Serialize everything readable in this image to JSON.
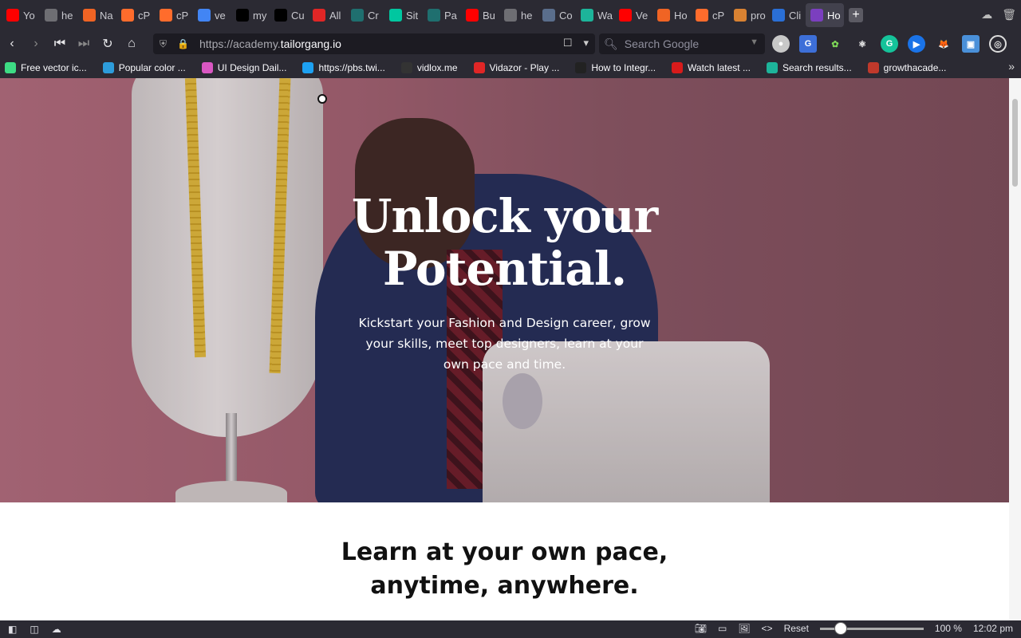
{
  "browser": {
    "tabs": [
      {
        "label": "Yo",
        "icon": "youtube-icon",
        "color": "#ff0000"
      },
      {
        "label": "he",
        "icon": "github-icon",
        "color": "#6e6e73"
      },
      {
        "label": "Na",
        "icon": "namecheap-icon",
        "color": "#f06424"
      },
      {
        "label": "cP",
        "icon": "cpanel-icon",
        "color": "#ff6c2c"
      },
      {
        "label": "cP",
        "icon": "cpanel-icon",
        "color": "#ff6c2c"
      },
      {
        "label": "ve",
        "icon": "google-icon",
        "color": "#4285f4"
      },
      {
        "label": "my",
        "icon": "triangle-icon",
        "color": "#000000"
      },
      {
        "label": "Cu",
        "icon": "triangle-icon",
        "color": "#000000"
      },
      {
        "label": "All",
        "icon": "record-icon",
        "color": "#e02626"
      },
      {
        "label": "Cr",
        "icon": "react-icon",
        "color": "#1f6f6f"
      },
      {
        "label": "Sit",
        "icon": "diamond-icon",
        "color": "#00c7a0"
      },
      {
        "label": "Pa",
        "icon": "react-icon",
        "color": "#1f6f6f"
      },
      {
        "label": "Bu",
        "icon": "youtube-icon",
        "color": "#ff0000"
      },
      {
        "label": "he",
        "icon": "github-icon",
        "color": "#6e6e73"
      },
      {
        "label": "Co",
        "icon": "alien-icon",
        "color": "#5a6e8c"
      },
      {
        "label": "Wa",
        "icon": "s-logo-icon",
        "color": "#1db49a"
      },
      {
        "label": "Ve",
        "icon": "youtube-icon",
        "color": "#ff0000"
      },
      {
        "label": "Ho",
        "icon": "namecheap-icon",
        "color": "#f06424"
      },
      {
        "label": "cP",
        "icon": "cpanel-icon",
        "color": "#ff6c2c"
      },
      {
        "label": "pro",
        "icon": "stripes-icon",
        "color": "#d98232"
      },
      {
        "label": "Cli",
        "icon": "bar-icon",
        "color": "#2a6fd6"
      },
      {
        "label": "Ho",
        "icon": "ta-logo-icon",
        "color": "#7b3fbf",
        "active": true
      }
    ],
    "url_prefix": "https://academy.",
    "url_domain": "tailorgang.io",
    "search_placeholder": "Search Google",
    "bookmarks": [
      {
        "label": "Free vector ic...",
        "icon": "vector-icon",
        "color": "#3ddc84"
      },
      {
        "label": "Popular color ...",
        "icon": "color-icon",
        "color": "#2d9cdb"
      },
      {
        "label": "UI Design Dail...",
        "icon": "ui-icon",
        "color": "#d957c2"
      },
      {
        "label": "https://pbs.twi...",
        "icon": "twitter-icon",
        "color": "#1da1f2"
      },
      {
        "label": "vidlox.me",
        "icon": "play-icon",
        "color": "#333333"
      },
      {
        "label": "Vidazor - Play ...",
        "icon": "v-icon",
        "color": "#e02626"
      },
      {
        "label": "How to Integr...",
        "icon": "c-icon",
        "color": "#222222"
      },
      {
        "label": "Watch latest ...",
        "icon": "m-icon",
        "color": "#d81b1b"
      },
      {
        "label": "Search results...",
        "icon": "s-logo-icon",
        "color": "#1db49a"
      },
      {
        "label": "growthacade...",
        "icon": "growth-icon",
        "color": "#c0392b"
      }
    ],
    "status": {
      "reset_label": "Reset",
      "zoom": "100 %",
      "time": "12:02 pm"
    }
  },
  "page": {
    "hero": {
      "title_line1": "Unlock your",
      "title_line2": "Potential.",
      "subtitle": "Kickstart your Fashion and Design career, grow your skills, meet top designers, learn at your own pace and time."
    },
    "section": {
      "title": "Learn at your own pace, anytime, anywhere."
    }
  }
}
